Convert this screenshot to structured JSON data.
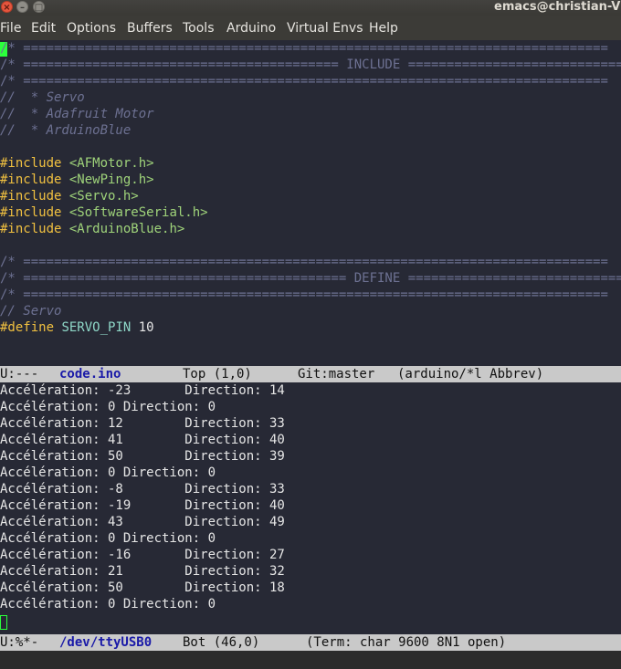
{
  "window": {
    "title": "emacs@christian-Vi"
  },
  "menubar": {
    "items": [
      "File",
      "Edit",
      "Options",
      "Buffers",
      "Tools",
      "Arduino",
      "Virtual Envs",
      "Help"
    ]
  },
  "editor": {
    "lines": [
      {
        "kind": "comment",
        "text": "/* ============================================================================"
      },
      {
        "kind": "comment",
        "text": "/* ========================================= INCLUDE ============================"
      },
      {
        "kind": "comment",
        "text": "/* ============================================================================"
      },
      {
        "kind": "comment-i",
        "text": "//  * Servo"
      },
      {
        "kind": "comment-i",
        "text": "//  * Adafruit Motor"
      },
      {
        "kind": "comment-i",
        "text": "//  * ArduinoBlue"
      },
      {
        "kind": "blank",
        "text": ""
      },
      {
        "kind": "include",
        "directive": "#include",
        "header": "<AFMotor.h>"
      },
      {
        "kind": "include",
        "directive": "#include",
        "header": "<NewPing.h>"
      },
      {
        "kind": "include",
        "directive": "#include",
        "header": "<Servo.h>"
      },
      {
        "kind": "include",
        "directive": "#include",
        "header": "<SoftwareSerial.h>"
      },
      {
        "kind": "include",
        "directive": "#include",
        "header": "<ArduinoBlue.h>"
      },
      {
        "kind": "blank",
        "text": ""
      },
      {
        "kind": "comment",
        "text": "/* ============================================================================"
      },
      {
        "kind": "comment",
        "text": "/* ========================================== DEFINE ============================"
      },
      {
        "kind": "comment",
        "text": "/* ============================================================================"
      },
      {
        "kind": "comment-i",
        "text": "// Servo"
      },
      {
        "kind": "define",
        "directive": "#define",
        "name": "SERVO_PIN",
        "value": "10"
      }
    ]
  },
  "modeline_top": {
    "status": "U:---",
    "buffer": "code.ino",
    "position": "Top (1,0)",
    "vc": "Git:master",
    "modes": "(arduino/*l Abbrev)"
  },
  "serial": {
    "lines": [
      "Accélération: -23       Direction: 14",
      "Accélération: 0 Direction: 0",
      "Accélération: 12        Direction: 33",
      "Accélération: 41        Direction: 40",
      "Accélération: 50        Direction: 39",
      "Accélération: 0 Direction: 0",
      "Accélération: -8        Direction: 33",
      "Accélération: -19       Direction: 40",
      "Accélération: 43        Direction: 49",
      "Accélération: 0 Direction: 0",
      "Accélération: -16       Direction: 27",
      "Accélération: 21        Direction: 32",
      "Accélération: 50        Direction: 18",
      "Accélération: 0 Direction: 0"
    ]
  },
  "modeline_bottom": {
    "status": "U:%*-",
    "buffer": "/dev/ttyUSB0",
    "position": "Bot (46,0)",
    "modes": "(Term: char 9600 8N1 open)"
  },
  "colors": {
    "background": "#272935",
    "cursor": "#2bff3c",
    "comment": "#6d7192",
    "preprocessor": "#f0c040",
    "include_header": "#9fd37a",
    "constant": "#8fd8c8"
  }
}
